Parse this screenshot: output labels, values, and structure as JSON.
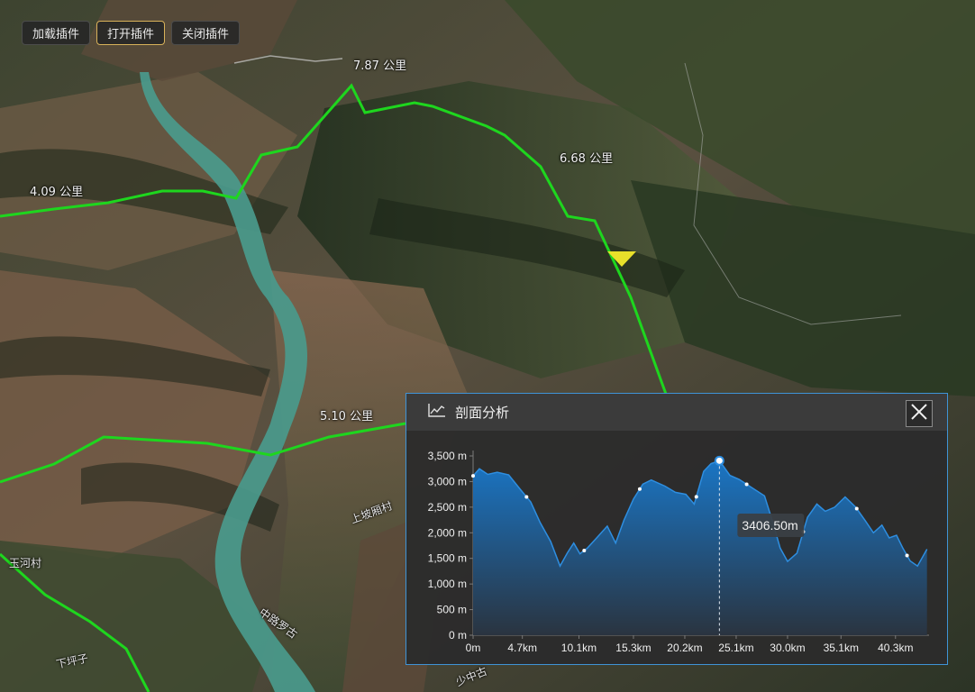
{
  "toolbar": {
    "load_label": "加载插件",
    "open_label": "打开插件",
    "close_label": "关闭插件"
  },
  "map": {
    "distance_labels": [
      "7.87 公里",
      "6.68 公里",
      "4.09 公里",
      "5.10 公里"
    ],
    "place_labels": [
      "玉河村",
      "上坡厢村",
      "下坪子",
      "少中古",
      "中路罗古"
    ]
  },
  "profile_panel": {
    "title": "剖面分析",
    "icon": "line-chart-icon",
    "close_icon": "close-icon",
    "tooltip": "3406.50m"
  },
  "colors": {
    "route": "#1ed61e",
    "area_fill_top": "#1a75c4",
    "area_fill_bottom": "#2a3440",
    "panel_border": "#3f93d6",
    "marker": "#e8e02a"
  },
  "chart_data": {
    "type": "area",
    "x_unit": "km",
    "y_unit": "m",
    "x_tick_labels": [
      "0m",
      "4.7km",
      "10.1km",
      "15.3km",
      "20.2km",
      "25.1km",
      "30.0km",
      "35.1km",
      "40.3km"
    ],
    "y_tick_labels": [
      "0 m",
      "500 m",
      "1,000 m",
      "1,500 m",
      "2,000 m",
      "2,500 m",
      "3,000 m",
      "3,500 m"
    ],
    "xlim": [
      0,
      43.5
    ],
    "ylim": [
      0,
      3500
    ],
    "x": [
      0,
      0.6,
      1.4,
      2.3,
      3.4,
      4.5,
      5.5,
      6.4,
      7.4,
      8.3,
      9.0,
      9.6,
      10.2,
      10.9,
      11.7,
      12.8,
      13.6,
      14.4,
      15.3,
      16.2,
      17.0,
      18.3,
      19.3,
      20.3,
      21.1,
      22.0,
      22.7,
      23.5,
      24.5,
      25.4,
      26.6,
      27.8,
      28.6,
      29.3,
      30.0,
      30.9,
      31.9,
      32.8,
      33.6,
      34.5,
      35.5,
      36.5,
      37.4,
      38.2,
      39.0,
      39.7,
      40.4,
      41.0,
      41.7,
      42.4,
      43.3
    ],
    "y": [
      3110,
      3250,
      3140,
      3180,
      3130,
      2850,
      2600,
      2200,
      1830,
      1350,
      1610,
      1800,
      1590,
      1700,
      1880,
      2130,
      1800,
      2250,
      2660,
      2950,
      3030,
      2910,
      2790,
      2750,
      2560,
      3200,
      3350,
      3406,
      3120,
      3040,
      2880,
      2720,
      2200,
      1700,
      1440,
      1600,
      2300,
      2560,
      2420,
      2500,
      2700,
      2500,
      2240,
      2000,
      2150,
      1900,
      1950,
      1700,
      1450,
      1350,
      1680
    ],
    "markers_x": [
      0,
      5.1,
      10.6,
      15.9,
      21.3,
      23.5,
      26.1,
      31.5,
      36.6,
      41.4
    ],
    "cursor_x": 23.5,
    "cursor_y": 3406.5
  }
}
